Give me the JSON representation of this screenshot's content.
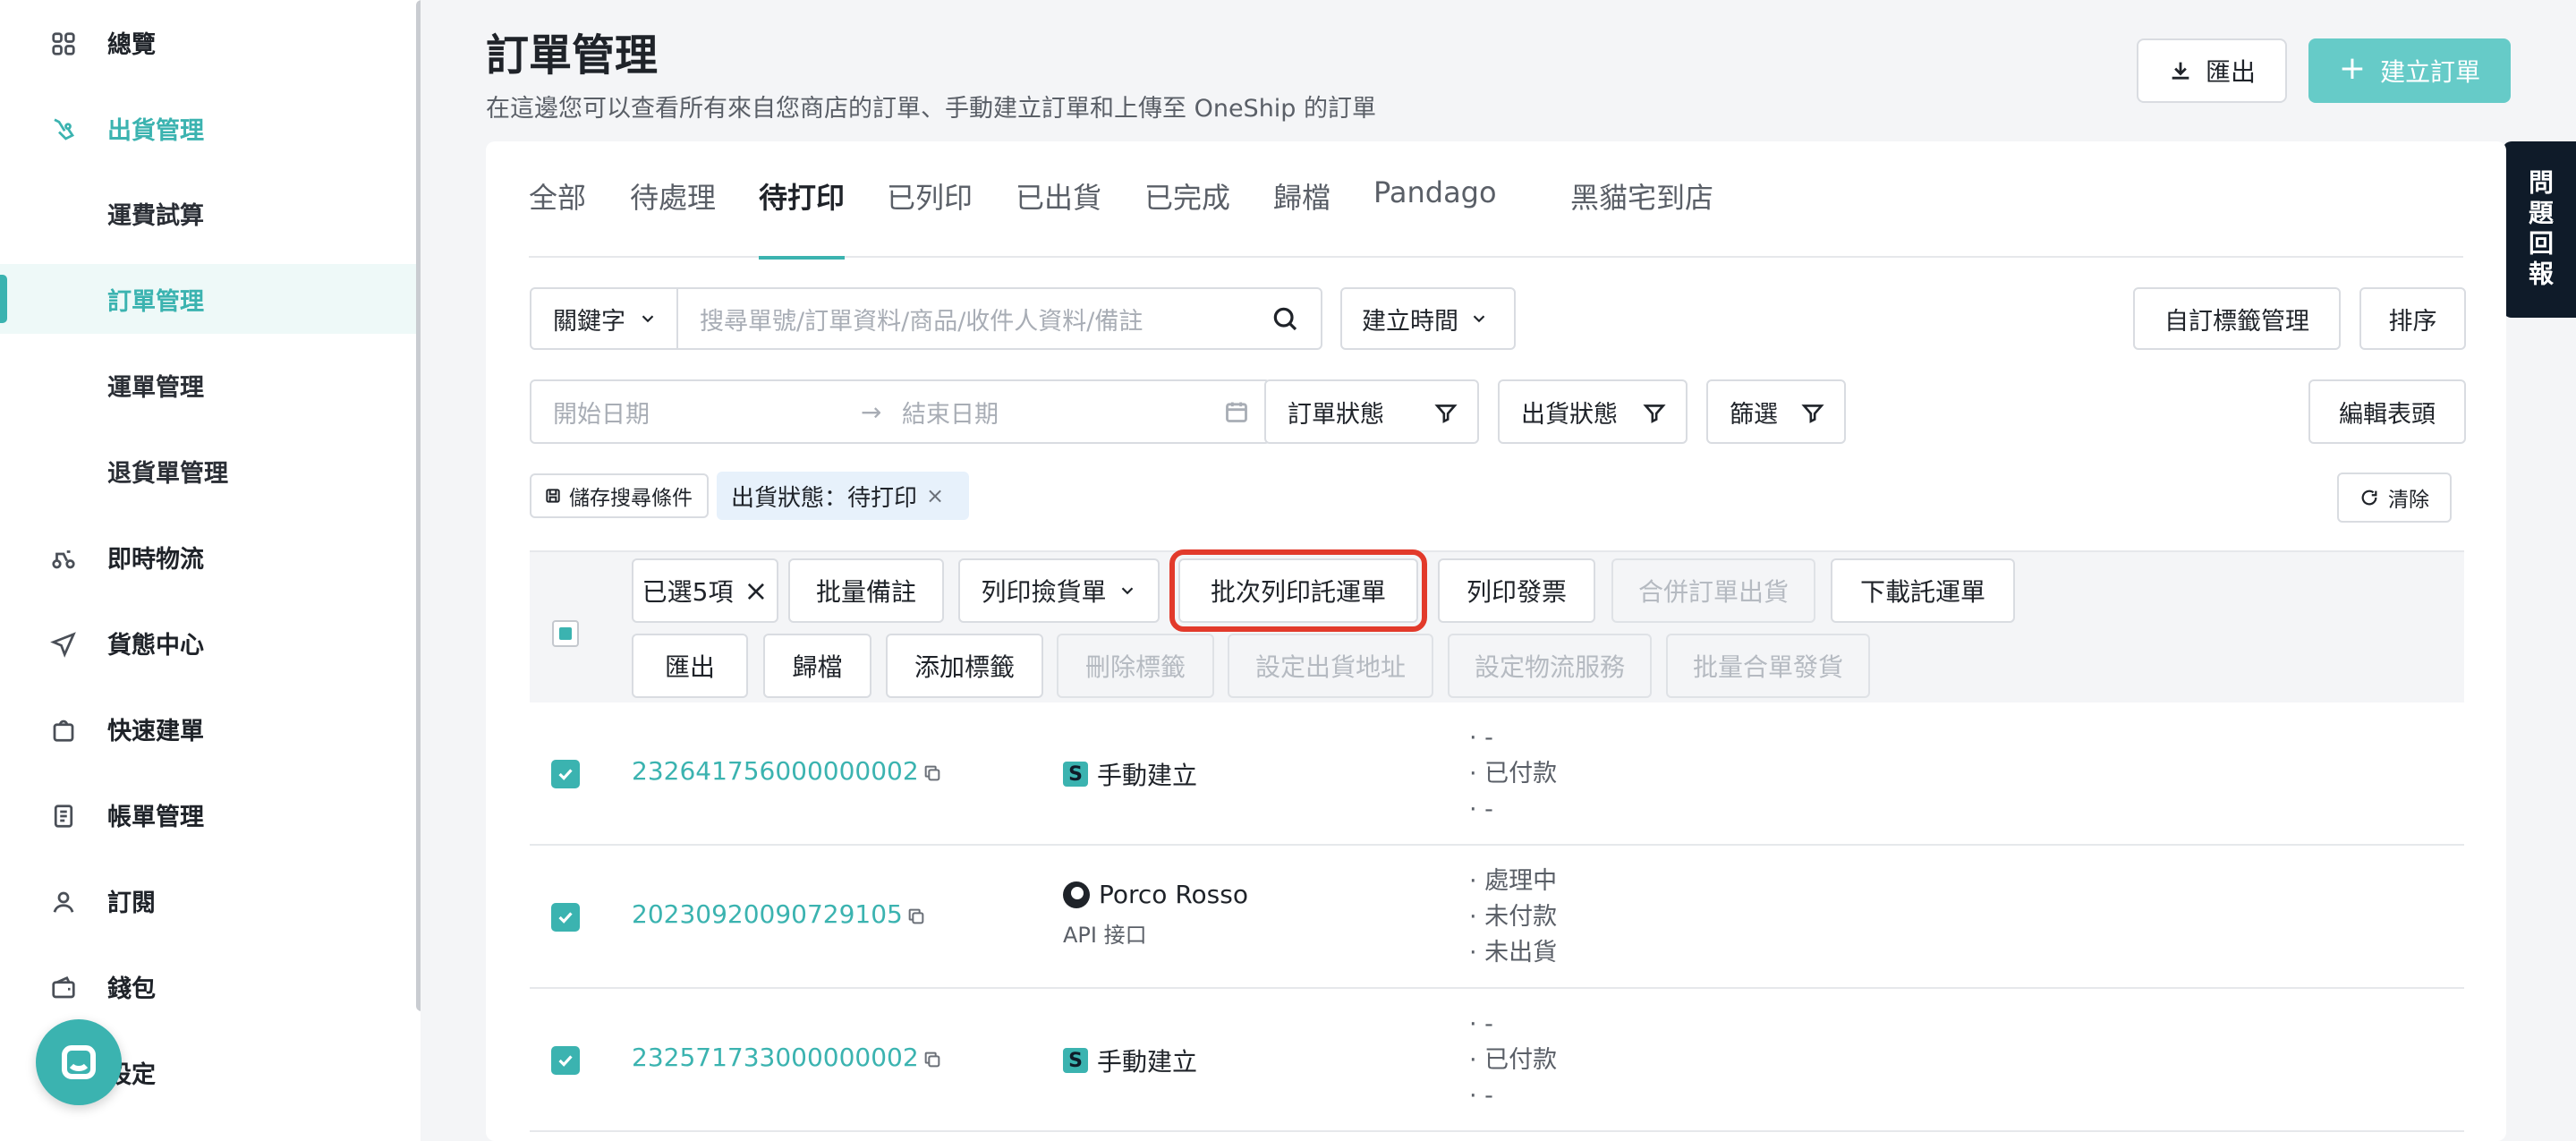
{
  "sidebar": {
    "items": [
      {
        "label": "總覽",
        "icon": "grid-icon"
      },
      {
        "label": "出貨管理",
        "icon": "shipping-hand-icon"
      },
      {
        "label": "運費試算"
      },
      {
        "label": "訂單管理"
      },
      {
        "label": "運單管理"
      },
      {
        "label": "退貨單管理"
      },
      {
        "label": "即時物流",
        "icon": "scooter-icon"
      },
      {
        "label": "貨態中心",
        "icon": "send-icon"
      },
      {
        "label": "快速建單",
        "icon": "bag-icon"
      },
      {
        "label": "帳單管理",
        "icon": "bill-icon"
      },
      {
        "label": "訂閱",
        "icon": "user-icon"
      },
      {
        "label": "錢包",
        "icon": "wallet-icon"
      },
      {
        "label": "設定",
        "icon": "gear-icon"
      }
    ]
  },
  "header": {
    "title": "訂單管理",
    "subtitle": "在這邊您可以查看所有來自您商店的訂單、手動建立訂單和上傳至 OneShip 的訂單",
    "export_label": "匯出",
    "create_label": "建立訂單",
    "feedback_label": "問題回報"
  },
  "tabs": [
    "全部",
    "待處理",
    "待打印",
    "已列印",
    "已出貨",
    "已完成",
    "歸檔",
    "Pandago",
    "黑貓宅到店"
  ],
  "active_tab": "待打印",
  "filters": {
    "keyword_label": "關鍵字",
    "search_placeholder": "搜尋單號/訂單資料/商品/收件人資料/備註",
    "created_time_label": "建立時間",
    "custom_tag_label": "自訂標籤管理",
    "sort_label": "排序",
    "start_date_placeholder": "開始日期",
    "end_date_placeholder": "結束日期",
    "order_status_label": "訂單狀態",
    "shipping_status_label": "出貨狀態",
    "filter_label": "篩選",
    "edit_header_label": "編輯表頭",
    "save_search_label": "儲存搜尋條件",
    "active_filter_chip": "出貨狀態：待打印",
    "clear_label": "清除"
  },
  "bulk_actions": {
    "selected_label": "已選5項",
    "row1": [
      "批量備註",
      "列印撿貨單",
      "批次列印託運單",
      "列印發票",
      "合併訂單出貨",
      "下載託運單"
    ],
    "row2": [
      "匯出",
      "歸檔",
      "添加標籤",
      "刪除標籤",
      "設定出貨地址",
      "設定物流服務",
      "批量合單發貨"
    ]
  },
  "orders": [
    {
      "id": "232641756000000002",
      "source": "手動建立",
      "source_sub": "",
      "statuses": [
        "-",
        "已付款",
        "-"
      ]
    },
    {
      "id": "20230920090729105",
      "source": "Porco Rosso",
      "source_sub": "API 接口",
      "statuses": [
        "處理中",
        "未付款",
        "未出貨"
      ]
    },
    {
      "id": "232571733000000002",
      "source": "手動建立",
      "source_sub": "",
      "statuses": [
        "-",
        "已付款",
        "-"
      ]
    }
  ],
  "colors": {
    "accent": "#3bb3b0",
    "highlight": "#e23a2b",
    "feedback_bg": "#0f1b29"
  }
}
